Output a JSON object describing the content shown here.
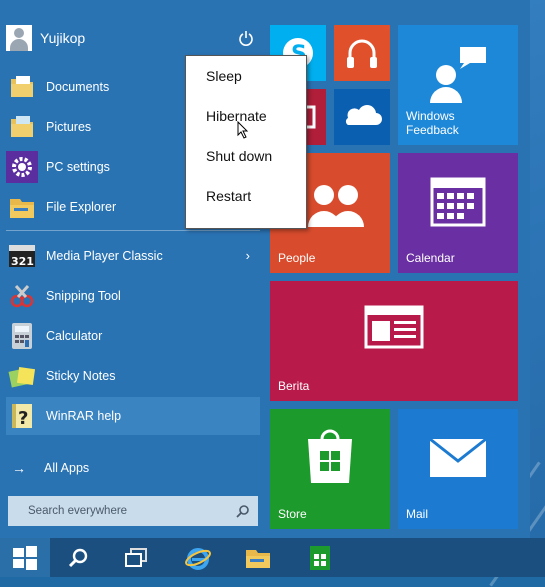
{
  "user": {
    "name": "Yujikop"
  },
  "pinned": [
    {
      "label": "Documents",
      "icon": "documents-folder-icon"
    },
    {
      "label": "Pictures",
      "icon": "pictures-folder-icon"
    },
    {
      "label": "PC settings",
      "icon": "settings-gear-icon"
    },
    {
      "label": "File Explorer",
      "icon": "file-explorer-icon"
    }
  ],
  "recent": [
    {
      "label": "Media Player Classic",
      "icon": "media-player-classic-icon",
      "arrow": "›"
    },
    {
      "label": "Snipping Tool",
      "icon": "snipping-tool-icon"
    },
    {
      "label": "Calculator",
      "icon": "calculator-icon"
    },
    {
      "label": "Sticky Notes",
      "icon": "sticky-notes-icon"
    },
    {
      "label": "WinRAR help",
      "icon": "winrar-help-icon"
    }
  ],
  "all_apps": {
    "arrow": "→",
    "label": "All Apps"
  },
  "search": {
    "placeholder": "Search everywhere"
  },
  "power_menu": [
    "Sleep",
    "Hibernate",
    "Shut down",
    "Restart"
  ],
  "tiles": {
    "windows_feedback": "Windows\nFeedback",
    "people": "People",
    "calendar": "Calendar",
    "berita": "Berita",
    "store": "Store",
    "mail": "Mail"
  },
  "colors": {
    "skype": "#00aff0",
    "music": "#e0502a",
    "video": "#b01e3a",
    "onedrive": "#0a5fb0",
    "feedback": "#1e88d8",
    "people": "#d84c2d",
    "calendar": "#6a2fa2",
    "berita": "#b81a4a",
    "store": "#1d9a2c",
    "mail": "#1c7bd1"
  }
}
